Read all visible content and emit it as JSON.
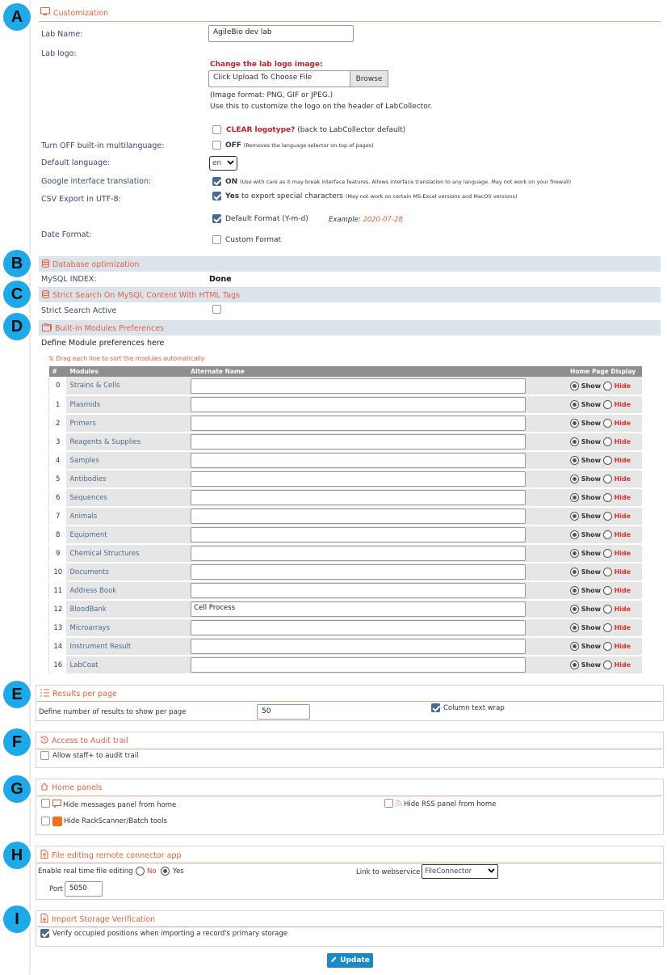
{
  "markers": [
    "A",
    "B",
    "C",
    "D",
    "E",
    "F",
    "G",
    "H",
    "I"
  ],
  "customization": {
    "title": "Customization",
    "lab_name_label": "Lab Name:",
    "lab_name_value": "AgileBio dev lab",
    "lab_logo_label": "Lab logo:",
    "change_logo": "Change the lab logo image:",
    "file_placeholder": "Click Upload To Choose File",
    "browse": "Browse",
    "image_format": "(Image format: PNG, GIF or JPEG.)",
    "use_this": "Use this to customize the logo on the header of LabCollector.",
    "clear_logo": "CLEAR logotype?",
    "clear_logo_note": "(back to LabCollector default)",
    "multilang_label": "Turn OFF built-in multilanguage:",
    "multilang_off": "OFF",
    "multilang_note": "(Removes the language selector on top of pages)",
    "default_lang_label": "Default language:",
    "default_lang_value": "en",
    "google_label": "Google interface translation:",
    "google_on": "ON",
    "google_note": "(Use with care as it may break interface features. Allows interface translation to any language. May not work on your firewall)",
    "csv_label": "CSV Export in UTF-8:",
    "csv_yes": "Yes",
    "csv_note": "to export special characters",
    "csv_small": "(May not work on certain MS-Excel versions and MacOS versions)",
    "date_label": "Date Format:",
    "date_default": "Default Format (Y-m-d)",
    "date_example_label": "Example:",
    "date_example_value": "2020-07-28",
    "date_custom": "Custom Format"
  },
  "db_opt": {
    "title": "Database optimization",
    "mysql_label": "MySQL INDEX:",
    "mysql_value": "Done"
  },
  "strict": {
    "title": "Strict Search On MySQL Content With HTML Tags",
    "label": "Strict Search Active"
  },
  "modules": {
    "title": "Built-in Modules Preferences",
    "define": "Define Module preferences here",
    "drag_note": "Drag each line to sort the modules automatically",
    "headers": [
      "#",
      "Modules",
      "Alternate Name",
      "Home Page Display"
    ],
    "show": "Show",
    "hide": "Hide",
    "rows": [
      {
        "num": "0",
        "name": "Strains & Cells",
        "alt": ""
      },
      {
        "num": "1",
        "name": "Plasmids",
        "alt": ""
      },
      {
        "num": "2",
        "name": "Primers",
        "alt": ""
      },
      {
        "num": "3",
        "name": "Reagents & Supplies",
        "alt": ""
      },
      {
        "num": "4",
        "name": "Samples",
        "alt": ""
      },
      {
        "num": "5",
        "name": "Antibodies",
        "alt": ""
      },
      {
        "num": "6",
        "name": "Sequences",
        "alt": ""
      },
      {
        "num": "7",
        "name": "Animals",
        "alt": ""
      },
      {
        "num": "8",
        "name": "Equipment",
        "alt": ""
      },
      {
        "num": "9",
        "name": "Chemical Structures",
        "alt": ""
      },
      {
        "num": "10",
        "name": "Documents",
        "alt": ""
      },
      {
        "num": "11",
        "name": "Address Book",
        "alt": ""
      },
      {
        "num": "12",
        "name": "BloodBank",
        "alt": "Cell Process"
      },
      {
        "num": "13",
        "name": "Microarrays",
        "alt": ""
      },
      {
        "num": "14",
        "name": "Instrument Result",
        "alt": ""
      },
      {
        "num": "16",
        "name": "LabCoat",
        "alt": ""
      }
    ]
  },
  "results": {
    "title": "Results per page",
    "label": "Define number of results to show per page",
    "value": "50",
    "wrap": "Column text wrap"
  },
  "audit": {
    "title": "Access to Audit trail",
    "label": "Allow staff+ to audit trail"
  },
  "home": {
    "title": "Home panels",
    "messages": "Hide messages panel from home",
    "rss": "Hide RSS panel from home",
    "rack": "Hide RackScanner/Batch tools"
  },
  "connector": {
    "title": "File editing remote connector app",
    "enable_label": "Enable real time file editing",
    "no": "No",
    "yes": "Yes",
    "link_label": "Link to webservice",
    "link_value": "FileConnector",
    "port_label": "Port",
    "port_value": "5050"
  },
  "import": {
    "title": "Import Storage Verification",
    "label": "Verify occupied positions when importing a record's primary storage"
  },
  "update": "Update",
  "colors": {
    "accent": "#e8603c",
    "marker": "#1fa9e8",
    "button": "#1b8ac4"
  }
}
